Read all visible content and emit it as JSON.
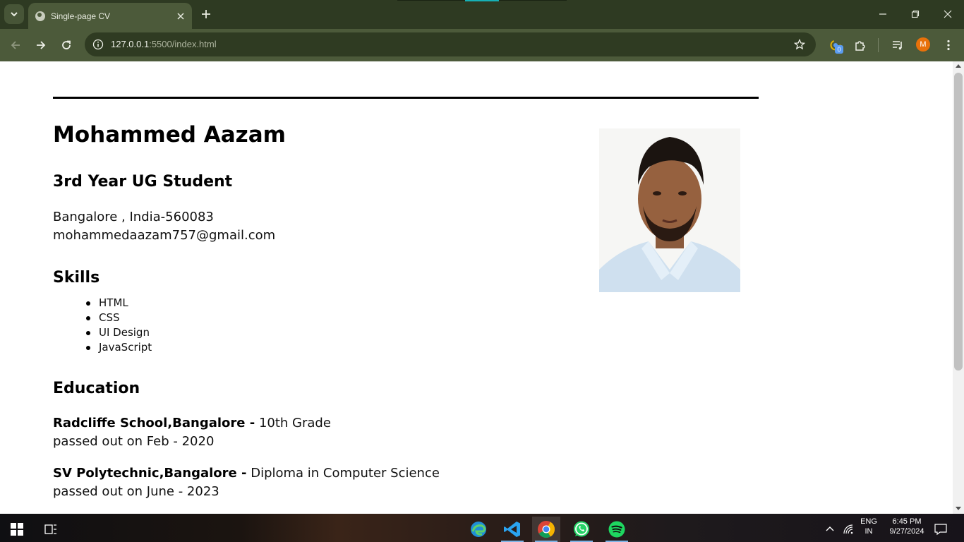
{
  "browser": {
    "tab_title": "Single-page CV",
    "url_host": "127.0.0.1",
    "url_rest": ":5500/index.html",
    "extension_badge": "0",
    "profile_initial": "M"
  },
  "cv": {
    "name": "Mohammed Aazam",
    "role": "3rd Year UG Student",
    "location": "Bangalore , India-560083",
    "email": "mohammedaazam757@gmail.com",
    "skills_heading": "Skills",
    "skills": [
      "HTML",
      "CSS",
      "UI Design",
      "JavaScript"
    ],
    "education_heading": "Education",
    "education": [
      {
        "school": "Radcliffe School,Bangalore -",
        "qualification": "10th Grade",
        "passed": "passed out on Feb - 2020"
      },
      {
        "school": "SV Polytechnic,Bangalore -",
        "qualification": "Diploma in Computer Science",
        "passed": "passed out on June - 2023"
      }
    ]
  },
  "taskbar": {
    "language_top": "ENG",
    "language_bottom": "IN",
    "time": "6:45 PM",
    "date": "9/27/2024"
  },
  "colors": {
    "tabbar": "#2e3a22",
    "toolbar": "#4c5a3a",
    "omnibox": "#2f3b22",
    "avatar": "#e8710a"
  }
}
